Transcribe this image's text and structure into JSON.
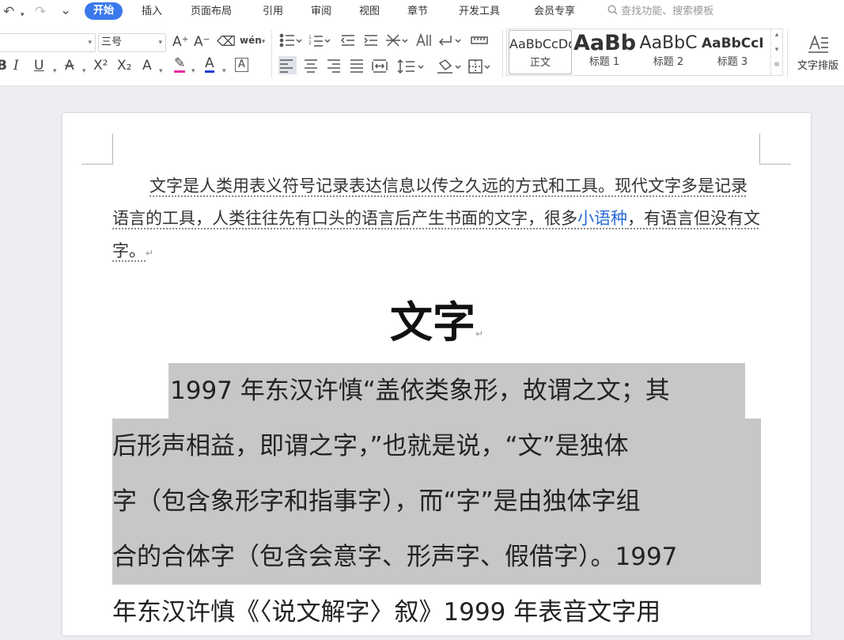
{
  "menubar": {
    "undo_icon": "↶",
    "redo_icon": "↷",
    "more_icon": "⌄",
    "tabs": [
      "开始",
      "插入",
      "页面布局",
      "引用",
      "审阅",
      "视图",
      "章节",
      "开发工具",
      "会员专享"
    ],
    "search_placeholder": "查找功能、搜索模板"
  },
  "ribbon": {
    "font_size": "三号",
    "grow_font": "A⁺",
    "shrink_font": "A⁻",
    "clear_format": "⌫",
    "pinyin": "wén",
    "bold": "B",
    "italic": "I",
    "underline": "U",
    "strikethrough": "A",
    "superscript": "X²",
    "subscript": "X₂",
    "text_effect": "A",
    "highlight": "✎",
    "font_color": "A",
    "char_border": "A",
    "styles": [
      {
        "sample": "AaBbCcDd",
        "name": "正文"
      },
      {
        "sample": "AaBb",
        "name": "标题 1"
      },
      {
        "sample": "AaBbC",
        "name": "标题 2"
      },
      {
        "sample": "AaBbCcI",
        "name": "标题 3"
      }
    ],
    "text_layout_label": "文字排版",
    "colors": {
      "highlight": "#e62ea0",
      "font": "#1f3dd6",
      "accent": "#3a79ec"
    }
  },
  "document": {
    "para1": {
      "before_link": "文字是人类用表义符号记录表达信息以传之久远的方式和工具。现代文字多是记录语言的工具，人类往往先有口头的语言后产生书面的文字，很多",
      "link": "小语种",
      "after_link": "，有语言但没有文字。",
      "mark": "↵"
    },
    "heading": "文字",
    "heading_mark": "↵",
    "body_lines": [
      "1997 年东汉许慎“盖依类象形，故谓之文；其",
      "后形声相益，即谓之字，”也就是说，“文”是独体",
      "字（包含象形字和指事字），而“字”是由独体字组",
      "合的合体字（包含会意字、形声字、假借字）。1997",
      "年东汉许慎《〈说文解字〉叙》1999 年表音文字用"
    ]
  }
}
